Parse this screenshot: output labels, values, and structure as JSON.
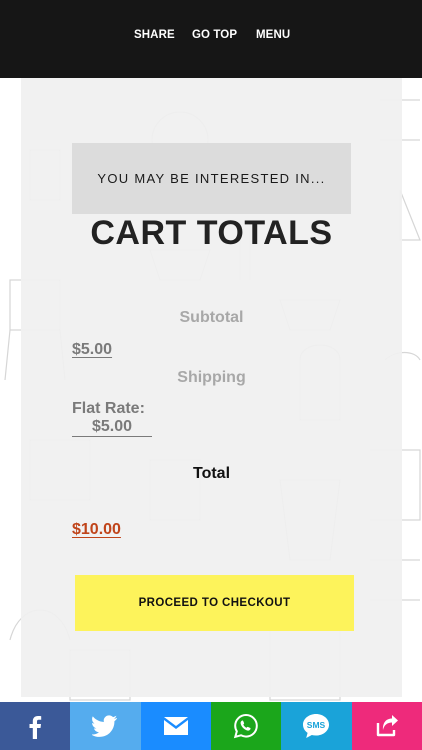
{
  "topbar": {
    "share_label": "SHARE",
    "gotop_label": "GO TOP",
    "menu_label": "MENU"
  },
  "interested": {
    "text": "YOU MAY BE INTERESTED IN..."
  },
  "cart": {
    "title": "CART TOTALS",
    "subtotal_label": "Subtotal",
    "subtotal_value": "$5.00",
    "shipping_label": "Shipping",
    "flat_rate_label": "Flat Rate:",
    "flat_rate_value": "$5.00",
    "total_label": "Total",
    "total_value": "$10.00",
    "checkout_label": "PROCEED TO CHECKOUT"
  },
  "colors": {
    "topbar_bg": "#161616",
    "checkout_bg": "#fdf35b",
    "total_value": "#c0441a",
    "muted_text": "#7a7a7a"
  },
  "share_bar": [
    {
      "icon": "facebook-icon",
      "color": "#3b5998"
    },
    {
      "icon": "twitter-icon",
      "color": "#55acee"
    },
    {
      "icon": "email-icon",
      "color": "#1a8cff"
    },
    {
      "icon": "whatsapp-icon",
      "color": "#1ba61b"
    },
    {
      "icon": "sms-icon",
      "color": "#1aa3d9"
    },
    {
      "icon": "share-icon",
      "color": "#ee2a7b"
    }
  ]
}
